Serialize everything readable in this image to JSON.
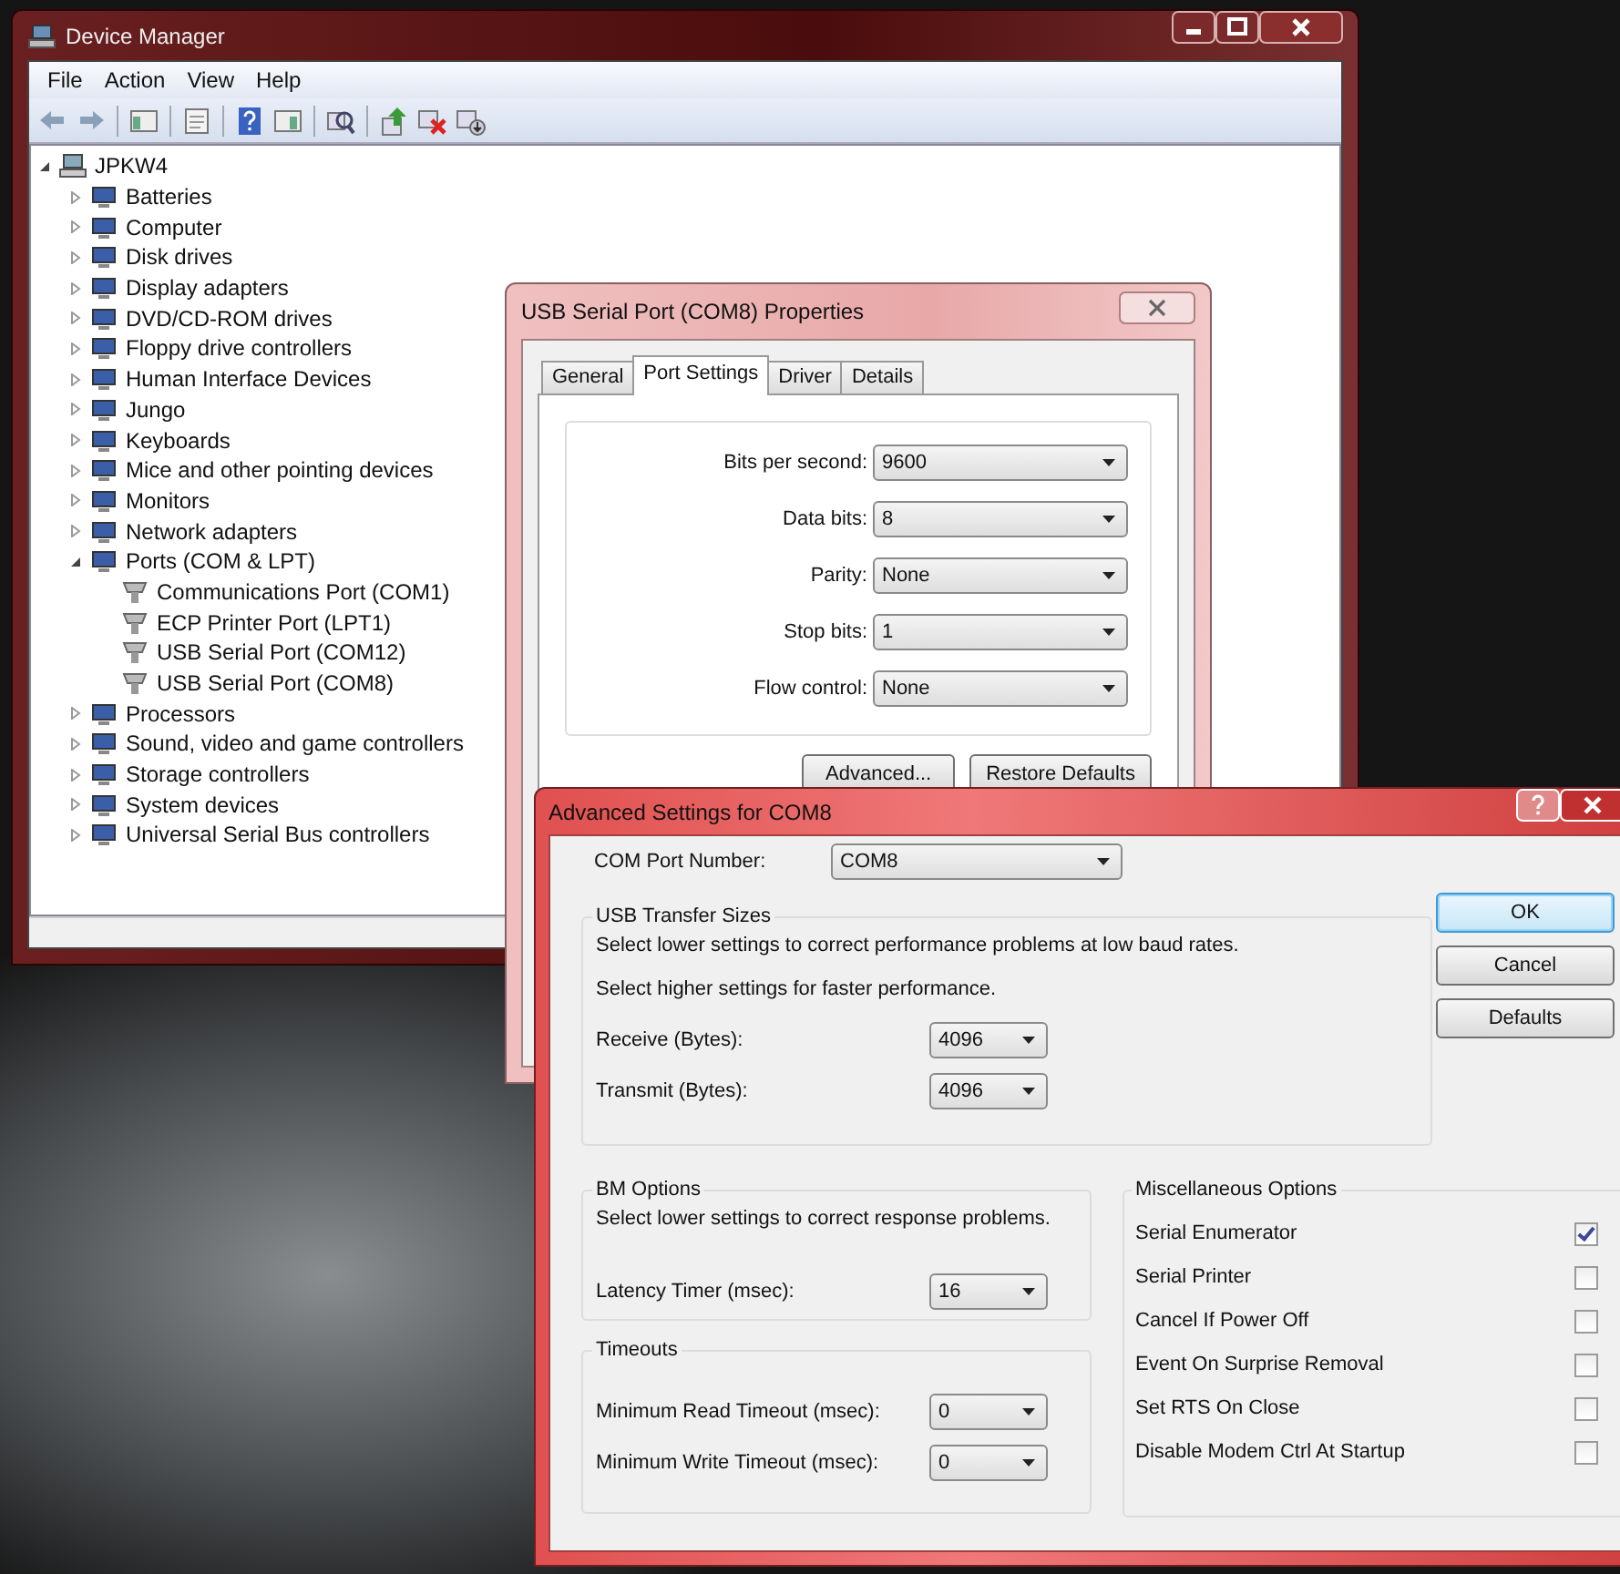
{
  "device_manager": {
    "title": "Device Manager",
    "menu": [
      "File",
      "Action",
      "View",
      "Help"
    ],
    "tree": {
      "label": "JPKW4",
      "expanded": true,
      "children": [
        {
          "label": "Batteries",
          "expanded": false
        },
        {
          "label": "Computer",
          "expanded": false
        },
        {
          "label": "Disk drives",
          "expanded": false
        },
        {
          "label": "Display adapters",
          "expanded": false
        },
        {
          "label": "DVD/CD-ROM drives",
          "expanded": false
        },
        {
          "label": "Floppy drive controllers",
          "expanded": false
        },
        {
          "label": "Human Interface Devices",
          "expanded": false
        },
        {
          "label": "Jungo",
          "expanded": false
        },
        {
          "label": "Keyboards",
          "expanded": false
        },
        {
          "label": "Mice and other pointing devices",
          "expanded": false
        },
        {
          "label": "Monitors",
          "expanded": false
        },
        {
          "label": "Network adapters",
          "expanded": false
        },
        {
          "label": "Ports (COM & LPT)",
          "expanded": true,
          "children": [
            {
              "label": "Communications Port (COM1)"
            },
            {
              "label": "ECP Printer Port (LPT1)"
            },
            {
              "label": "USB Serial Port (COM12)"
            },
            {
              "label": "USB Serial Port (COM8)"
            }
          ]
        },
        {
          "label": "Processors",
          "expanded": false
        },
        {
          "label": "Sound, video and game controllers",
          "expanded": false
        },
        {
          "label": "Storage controllers",
          "expanded": false
        },
        {
          "label": "System devices",
          "expanded": false
        },
        {
          "label": "Universal Serial Bus controllers",
          "expanded": false
        }
      ]
    }
  },
  "properties_dialog": {
    "title": "USB Serial Port (COM8) Properties",
    "tabs": [
      {
        "label": "General",
        "selected": false
      },
      {
        "label": "Port Settings",
        "selected": true
      },
      {
        "label": "Driver",
        "selected": false
      },
      {
        "label": "Details",
        "selected": false
      }
    ],
    "fields": [
      {
        "label": "Bits per second:",
        "value": "9600"
      },
      {
        "label": "Data bits:",
        "value": "8"
      },
      {
        "label": "Parity:",
        "value": "None"
      },
      {
        "label": "Stop bits:",
        "value": "1"
      },
      {
        "label": "Flow control:",
        "value": "None"
      }
    ],
    "buttons": [
      "Advanced...",
      "Restore Defaults"
    ]
  },
  "advanced_dialog": {
    "title": "Advanced Settings for COM8",
    "com_port": {
      "label": "COM Port Number:",
      "value": "COM8"
    },
    "usb_transfer": {
      "title": "USB Transfer Sizes",
      "notes": [
        "Select lower settings to correct performance problems at low baud rates.",
        "Select higher settings for faster performance."
      ],
      "fields": [
        {
          "label": "Receive (Bytes):",
          "value": "4096"
        },
        {
          "label": "Transmit (Bytes):",
          "value": "4096"
        }
      ]
    },
    "bm_options": {
      "title": "BM Options",
      "notes": [
        "Select lower settings to correct response problems."
      ],
      "fields": [
        {
          "label": "Latency Timer (msec):",
          "value": "16"
        }
      ]
    },
    "timeouts": {
      "title": "Timeouts",
      "fields": [
        {
          "label": "Minimum Read Timeout (msec):",
          "value": "0"
        },
        {
          "label": "Minimum Write Timeout (msec):",
          "value": "0"
        }
      ]
    },
    "misc_options": {
      "title": "Miscellaneous Options",
      "options": [
        {
          "label": "Serial Enumerator",
          "checked": true
        },
        {
          "label": "Serial Printer",
          "checked": false
        },
        {
          "label": "Cancel If Power Off",
          "checked": false
        },
        {
          "label": "Event On Surprise Removal",
          "checked": false
        },
        {
          "label": "Set RTS On Close",
          "checked": false
        },
        {
          "label": "Disable Modem Ctrl At Startup",
          "checked": false
        }
      ]
    },
    "buttons": [
      {
        "label": "OK",
        "default": true
      },
      {
        "label": "Cancel",
        "default": false
      },
      {
        "label": "Defaults",
        "default": false
      }
    ]
  }
}
